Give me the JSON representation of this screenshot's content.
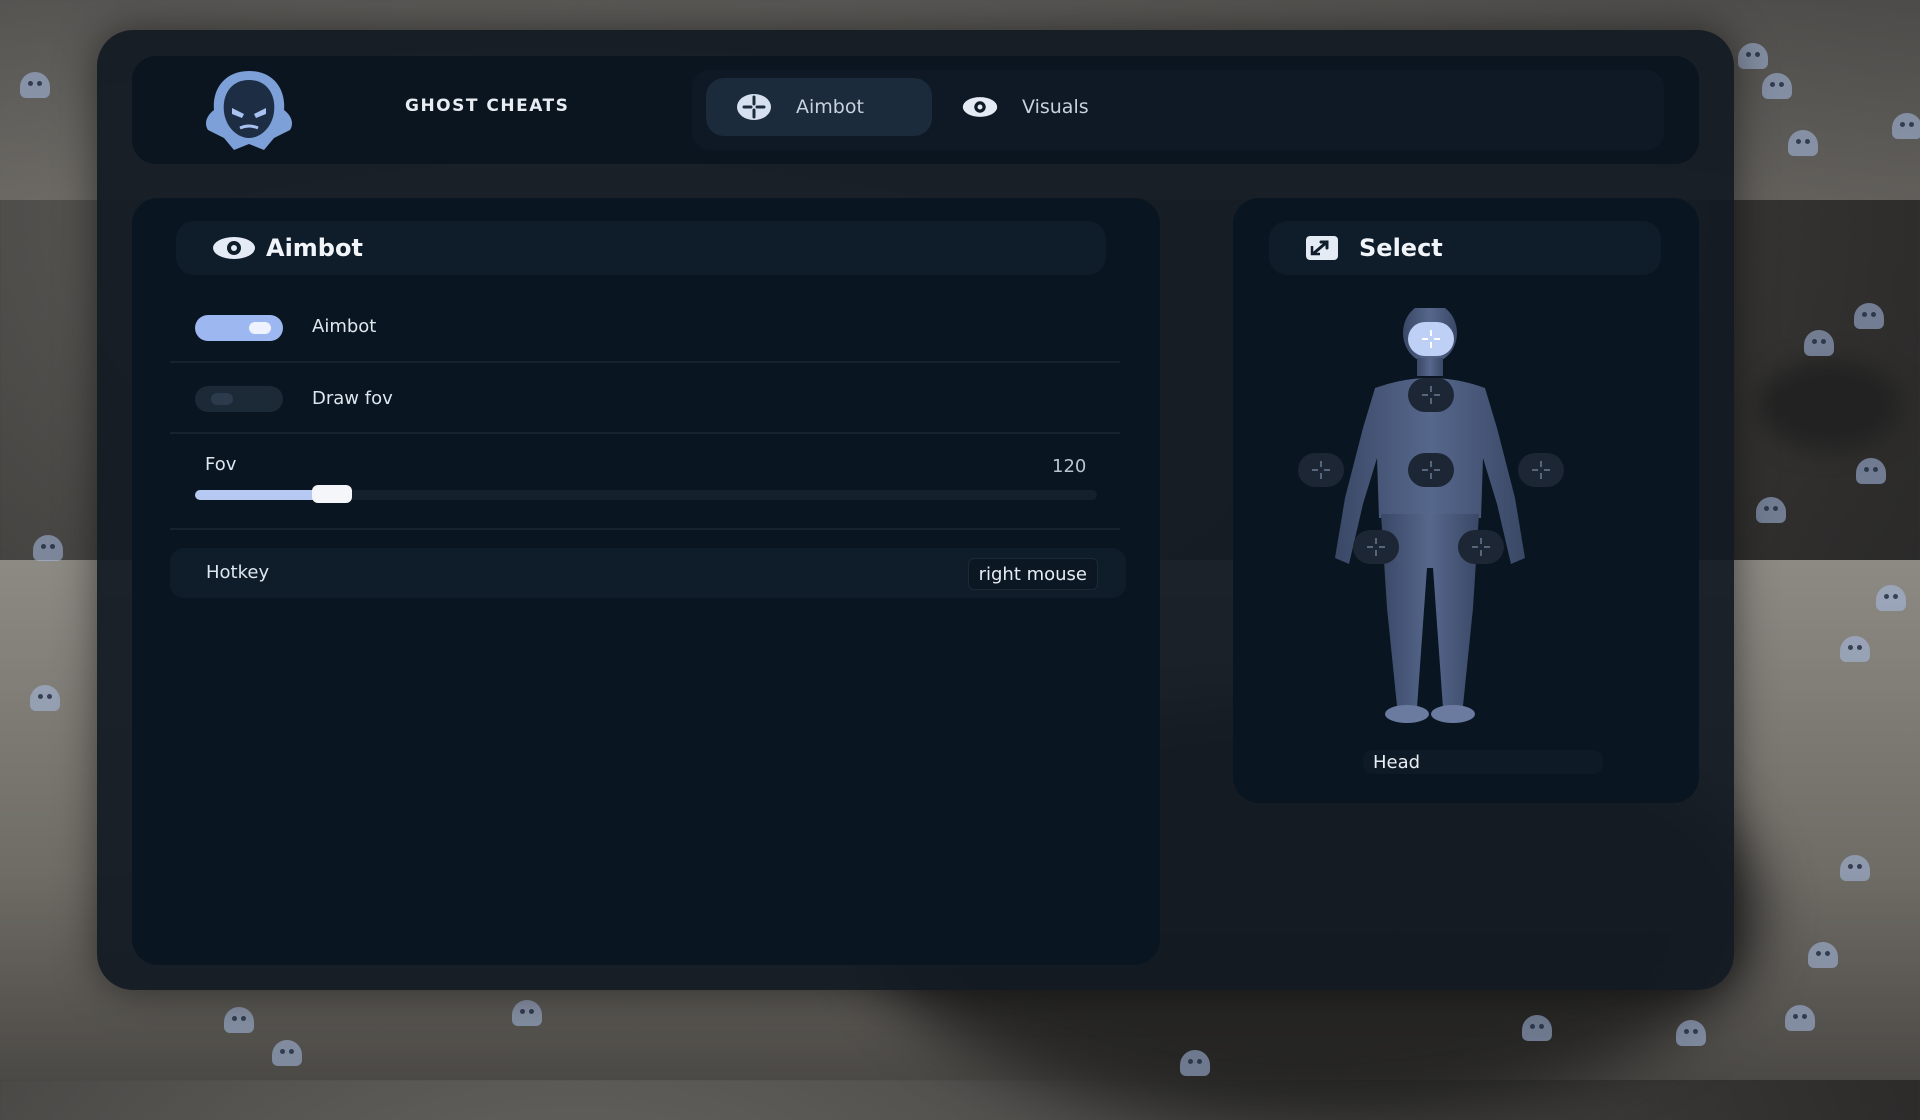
{
  "app": {
    "brand": "GHOST CHEATS"
  },
  "nav": {
    "tabs": [
      {
        "label": "Aimbot",
        "icon": "crosshair-icon",
        "active": true
      },
      {
        "label": "Visuals",
        "icon": "eye-icon",
        "active": false
      }
    ]
  },
  "aimbot_panel": {
    "title": "Aimbot",
    "icon": "eye-icon",
    "toggles": [
      {
        "label": "Aimbot",
        "on": true
      },
      {
        "label": "Draw fov",
        "on": false
      }
    ],
    "fov": {
      "label": "Fov",
      "value": "120",
      "fraction": 0.13
    },
    "hotkey": {
      "label": "Hotkey",
      "value": "right mouse"
    }
  },
  "select_panel": {
    "title": "Select",
    "icon": "expand-icon",
    "targets": [
      "head",
      "neck",
      "left-arm",
      "chest",
      "right-arm",
      "left-leg",
      "right-leg"
    ],
    "selected": "Head"
  },
  "colors": {
    "accent": "#9db8f0",
    "panel": "#091520",
    "window": "#121a22"
  }
}
